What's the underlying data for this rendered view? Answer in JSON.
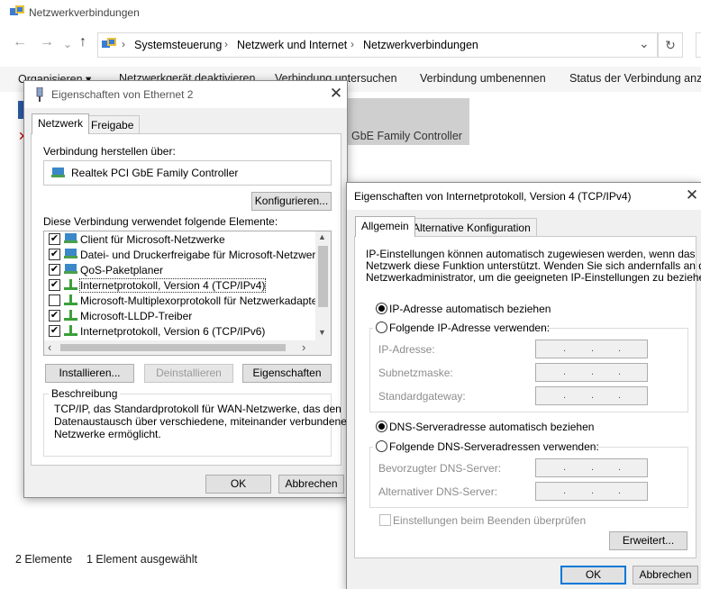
{
  "window": {
    "title": "Netzwerkverbindungen"
  },
  "address": {
    "crumbs": [
      "Systemsteuerung",
      "Netzwerk und Internet",
      "Netzwerkverbindungen"
    ]
  },
  "toolbar": {
    "organize": "Organisieren ▾",
    "disable": "Netzwerkgerät deaktivieren",
    "diagnose": "Verbindung untersuchen",
    "rename": "Verbindung umbenennen",
    "status": "Status der Verbindung anzeigen"
  },
  "adapter": {
    "label": "GbE Family Controller"
  },
  "status": {
    "count": "2 Elemente",
    "selected": "1 Element ausgewählt"
  },
  "eth": {
    "title": "Eigenschaften von Ethernet 2",
    "tabs": [
      "Netzwerk",
      "Freigabe"
    ],
    "connect_via_label": "Verbindung herstellen über:",
    "adapter_name": "Realtek PCI GbE Family Controller",
    "configure_btn": "Konfigurieren...",
    "items_label": "Diese Verbindung verwendet folgende Elemente:",
    "items": [
      {
        "label": "Client für Microsoft-Netzwerke",
        "checked": "✔"
      },
      {
        "label": "Datei- und Druckerfreigabe für Microsoft-Netzwerke",
        "checked": "✔"
      },
      {
        "label": "QoS-Paketplaner",
        "checked": "✔"
      },
      {
        "label": "Internetprotokoll, Version 4 (TCP/IPv4)",
        "checked": "✔"
      },
      {
        "label": "Microsoft-Multiplexorprotokoll für Netzwerkadapter",
        "checked": ""
      },
      {
        "label": "Microsoft-LLDP-Treiber",
        "checked": "✔"
      },
      {
        "label": "Internetprotokoll, Version 6 (TCP/IPv6)",
        "checked": "✔"
      }
    ],
    "install_btn": "Installieren...",
    "uninstall_btn": "Deinstallieren",
    "properties_btn": "Eigenschaften",
    "description_label": "Beschreibung",
    "description_lines": [
      "TCP/IP, das Standardprotokoll für WAN-Netzwerke, das den",
      "Datenaustausch über verschiedene, miteinander verbundene",
      "Netzwerke ermöglicht."
    ],
    "ok_btn": "OK",
    "cancel_btn": "Abbrechen"
  },
  "ipv4": {
    "title": "Eigenschaften von Internetprotokoll, Version 4 (TCP/IPv4)",
    "tabs": [
      "Allgemein",
      "Alternative Konfiguration"
    ],
    "intro_lines": [
      "IP-Einstellungen können automatisch zugewiesen werden, wenn das",
      "Netzwerk diese Funktion unterstützt. Wenden Sie sich andernfalls an den",
      "Netzwerkadministrator, um die geeigneten IP-Einstellungen zu beziehen."
    ],
    "ip_auto": "IP-Adresse automatisch beziehen",
    "ip_manual": "Folgende IP-Adresse verwenden:",
    "ip_address_label": "IP-Adresse:",
    "subnet_label": "Subnetzmaske:",
    "gateway_label": "Standardgateway:",
    "dns_auto": "DNS-Serveradresse automatisch beziehen",
    "dns_manual": "Folgende DNS-Serveradressen verwenden:",
    "dns_pref_label": "Bevorzugter DNS-Server:",
    "dns_alt_label": "Alternativer DNS-Server:",
    "validate_label": "Einstellungen beim Beenden überprüfen",
    "advanced_btn": "Erweitert...",
    "ok_btn": "OK",
    "cancel_btn": "Abbrechen",
    "ip_dot": "."
  }
}
